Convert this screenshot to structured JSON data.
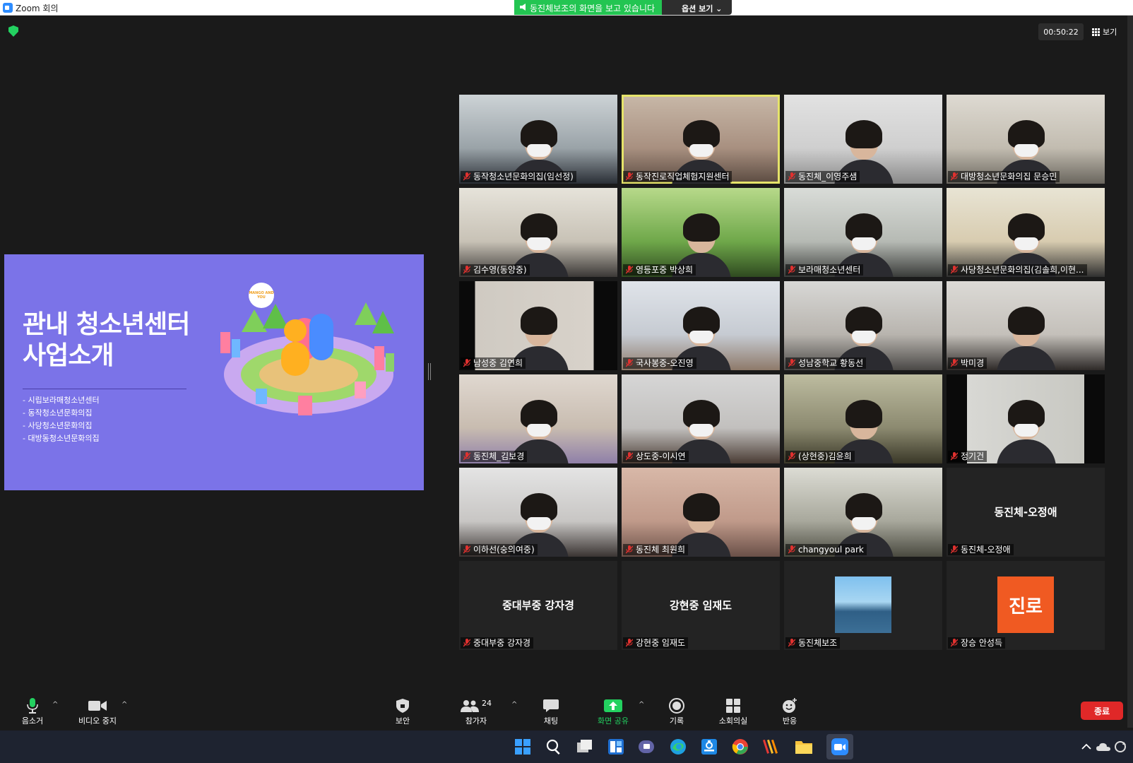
{
  "window": {
    "title": "Zoom 회의"
  },
  "share_banner": {
    "status": "동진체보조의 화면을 보고 있습니다",
    "options_label": "옵션 보기 ⌄"
  },
  "meeting": {
    "timer": "00:50:22",
    "view_label": "보기"
  },
  "slide": {
    "title_line1": "관내 청소년센터",
    "title_line2": "사업소개",
    "badge": "MANGO AND YOU",
    "items": [
      "시립보라매청소년센터",
      "동작청소년문화의집",
      "사당청소년문화의집",
      "대방동청소년문화의집"
    ]
  },
  "participants": [
    {
      "name": "동작청소년문화의집(임선정)",
      "type": "video"
    },
    {
      "name": "동작진로직업체험지원센터",
      "type": "video",
      "active": true
    },
    {
      "name": "동진체_이영주샘",
      "type": "video"
    },
    {
      "name": "대방청소년문화의집 문승민",
      "type": "video"
    },
    {
      "name": "김수영(동양중)",
      "type": "video"
    },
    {
      "name": "영등포중 박상희",
      "type": "video"
    },
    {
      "name": "보라매청소년센터",
      "type": "video"
    },
    {
      "name": "사당청소년문화의집(김솔희,이현...",
      "type": "video"
    },
    {
      "name": "남성중 김연희",
      "type": "video"
    },
    {
      "name": "국사봉중-오진영",
      "type": "video"
    },
    {
      "name": "성남중학교 황동선",
      "type": "video"
    },
    {
      "name": "박미경",
      "type": "video"
    },
    {
      "name": "동진체_김보경",
      "type": "video"
    },
    {
      "name": "상도중-이시연",
      "type": "video"
    },
    {
      "name": "(상현중)김윤희",
      "type": "video"
    },
    {
      "name": "정기건",
      "type": "video"
    },
    {
      "name": "이하선(숭의여중)",
      "type": "video"
    },
    {
      "name": "동진체 최원희",
      "type": "video"
    },
    {
      "name": "changyoul park",
      "type": "video"
    },
    {
      "name": "동진체-오정애",
      "type": "text",
      "display": "동진체-오정애"
    },
    {
      "name": "중대부중 강자경",
      "type": "text",
      "display": "중대부중 강자경"
    },
    {
      "name": "강현중 임재도",
      "type": "text",
      "display": "강현중 임재도"
    },
    {
      "name": "동진체보조",
      "type": "avatar-photo"
    },
    {
      "name": "장승 안성득",
      "type": "avatar-logo",
      "logo_text": "진로"
    }
  ],
  "toolbar": {
    "mute": "음소거",
    "video": "비디오 중지",
    "security": "보안",
    "participants": "참가자",
    "participants_count": "24",
    "chat": "채팅",
    "share": "화면 공유",
    "record": "기록",
    "breakout": "소회의실",
    "reactions": "반응",
    "end": "종료"
  },
  "colors": {
    "accent_green": "#23c552",
    "end_red": "#e02828",
    "slide_purple": "#7b73e8",
    "active_speaker": "#e5e36a"
  }
}
